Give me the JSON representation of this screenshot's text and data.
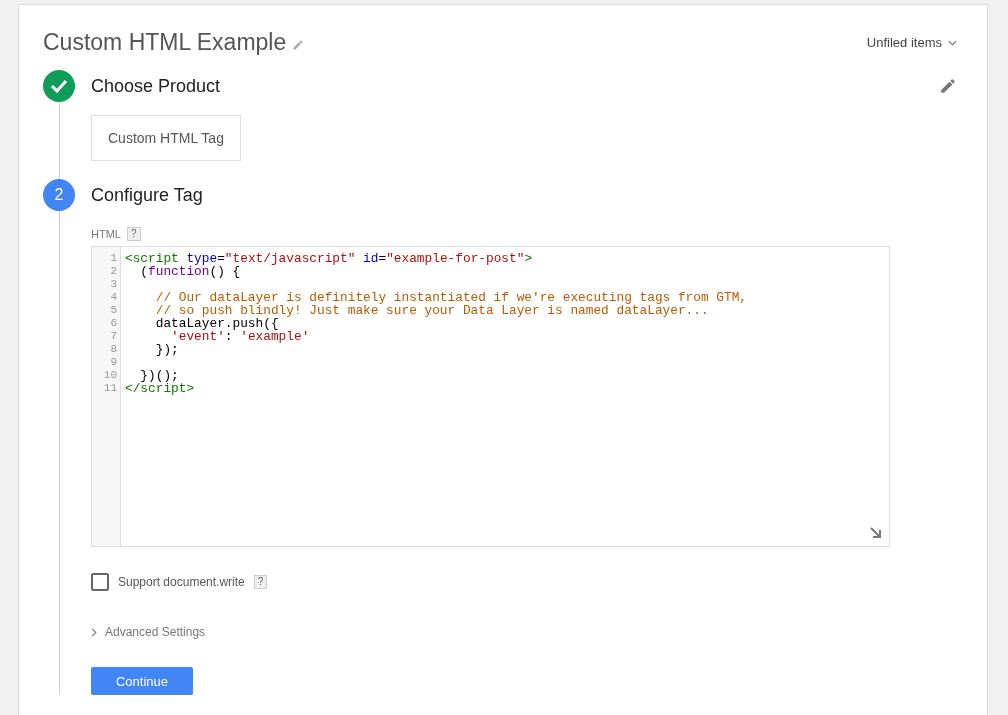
{
  "header": {
    "title": "Custom HTML Example",
    "folder_menu": "Unfiled items"
  },
  "steps": [
    {
      "title": "Choose Product",
      "completed": true,
      "product": "Custom HTML Tag"
    },
    {
      "number": "2",
      "title": "Configure Tag",
      "completed": false
    }
  ],
  "html_field": {
    "label": "HTML",
    "help": "?",
    "lines": [
      {
        "number": "1",
        "tokens": [
          {
            "kind": "tag",
            "text": "<script"
          },
          {
            "kind": "attr",
            "text": " type"
          },
          {
            "kind": "plain",
            "text": "="
          },
          {
            "kind": "string",
            "text": "\"text/javascript\""
          },
          {
            "kind": "attr",
            "text": " id"
          },
          {
            "kind": "plain",
            "text": "="
          },
          {
            "kind": "string",
            "text": "\"example-for-post\""
          },
          {
            "kind": "tag",
            "text": ">"
          }
        ]
      },
      {
        "number": "2",
        "tokens": [
          {
            "kind": "plain",
            "text": "  ("
          },
          {
            "kind": "keyword",
            "text": "function"
          },
          {
            "kind": "plain",
            "text": "() {"
          }
        ]
      },
      {
        "number": "3"
      },
      {
        "number": "4",
        "tokens": [
          {
            "kind": "comment",
            "text": "    // Our dataLayer is definitely instantiated if we're executing tags from GTM,"
          }
        ]
      },
      {
        "number": "5",
        "tokens": [
          {
            "kind": "comment",
            "text": "    // so push blindly! Just make sure your Data Layer is named dataLayer..."
          }
        ]
      },
      {
        "number": "6",
        "tokens": [
          {
            "kind": "plain",
            "text": "    dataLayer.push({"
          }
        ]
      },
      {
        "number": "7",
        "tokens": [
          {
            "kind": "string",
            "text": "      'event'"
          },
          {
            "kind": "plain",
            "text": ": "
          },
          {
            "kind": "string",
            "text": "'example'"
          }
        ]
      },
      {
        "number": "8",
        "tokens": [
          {
            "kind": "plain",
            "text": "    });"
          }
        ]
      },
      {
        "number": "9"
      },
      {
        "number": "10",
        "tokens": [
          {
            "kind": "plain",
            "text": "  })();"
          }
        ]
      },
      {
        "number": "11",
        "tokens": [
          {
            "kind": "tag",
            "text": "</script>"
          }
        ]
      }
    ]
  },
  "support_document_write": {
    "label": "Support document.write",
    "checked": false,
    "help": "?"
  },
  "advanced_settings": {
    "label": "Advanced Settings",
    "expanded": false
  },
  "continue_button": "Continue"
}
